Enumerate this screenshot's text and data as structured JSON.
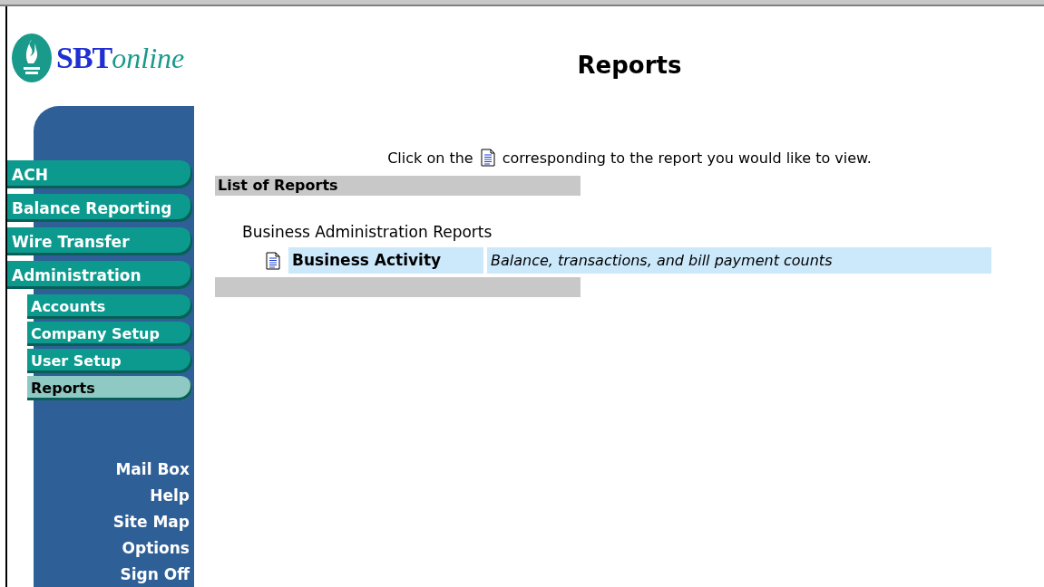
{
  "logo": {
    "brand": "SBT",
    "suffix": "online"
  },
  "nav": [
    {
      "label": "ACH",
      "kind": "main",
      "selected": false
    },
    {
      "label": "Balance Reporting",
      "kind": "main",
      "selected": false
    },
    {
      "label": "Wire Transfer",
      "kind": "main",
      "selected": false
    },
    {
      "label": "Administration",
      "kind": "main",
      "selected": false
    },
    {
      "label": "Accounts",
      "kind": "sub",
      "selected": false
    },
    {
      "label": "Company Setup",
      "kind": "sub",
      "selected": false
    },
    {
      "label": "User Setup",
      "kind": "sub",
      "selected": false
    },
    {
      "label": "Reports",
      "kind": "sub",
      "selected": true
    }
  ],
  "links": [
    "Mail Box",
    "Help",
    "Site Map",
    "Options",
    "Sign Off"
  ],
  "title": "Reports",
  "instruction": {
    "before": "Click on the",
    "after": "corresponding to the report you would like to view."
  },
  "list": {
    "heading": "List of Reports",
    "groups": [
      {
        "label": "Business Administration Reports",
        "reports": [
          {
            "name": "Business Activity",
            "description": "Balance, transactions, and bill payment counts"
          }
        ]
      }
    ]
  }
}
